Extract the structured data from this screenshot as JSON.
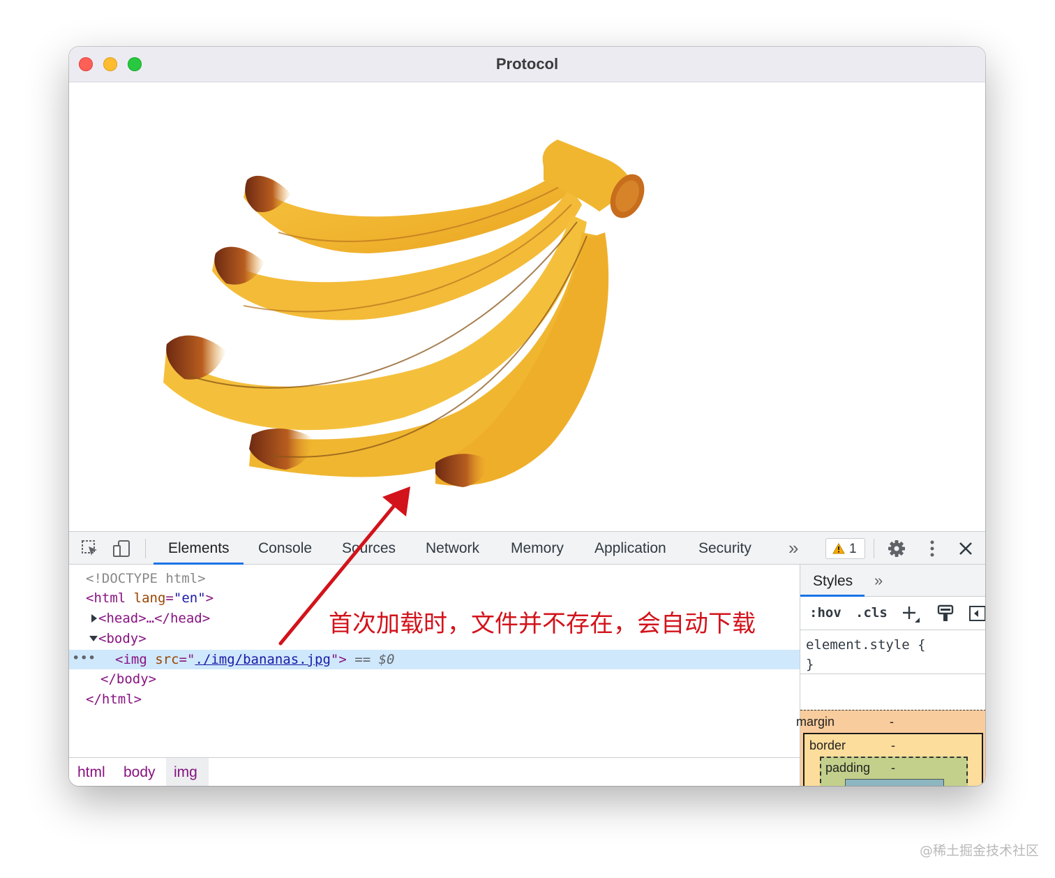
{
  "window": {
    "title": "Protocol"
  },
  "devtools": {
    "tabs": [
      {
        "label": "Elements",
        "active": true
      },
      {
        "label": "Console"
      },
      {
        "label": "Sources"
      },
      {
        "label": "Network"
      },
      {
        "label": "Memory"
      },
      {
        "label": "Application"
      },
      {
        "label": "Security"
      }
    ],
    "more_tabs_label": "»",
    "warning_count": "1",
    "close_label": "✕",
    "dom": {
      "doctype": "<!DOCTYPE html>",
      "html_open_tag": "<html",
      "html_attr_name": "lang",
      "html_attr_value": "\"en\"",
      "head_collapsed": "<head>…</head>",
      "body_open": "<body>",
      "img_tag_open": "<img",
      "img_attr_name": "src",
      "img_src": "./img/bananas.jpg",
      "img_marker": "== $0",
      "body_close": "</body>",
      "html_close": "</html>"
    },
    "breadcrumbs": [
      "html",
      "body",
      "img"
    ],
    "styles": {
      "tab_label": "Styles",
      "more_label": "»",
      "hov_label": ":hov",
      "cls_label": ".cls",
      "rule_selector": "element.style {",
      "rule_close": "}",
      "box_model": {
        "margin_label": "margin",
        "margin_value": "-",
        "border_label": "border",
        "border_value": "-",
        "padding_label": "padding",
        "padding_value": "-"
      }
    }
  },
  "annotation": {
    "text": "首次加载时，文件并不存在，会自动下载",
    "color": "#d2131b"
  },
  "watermark": "@稀土掘金技术社区",
  "icons": [
    "inspect-icon",
    "device-toolbar-icon",
    "warning-icon",
    "gear-icon",
    "kebab-menu-icon",
    "close-icon",
    "new-rule-icon",
    "paint-brush-icon",
    "sidebar-toggle-icon",
    "expand-triangle-icon"
  ]
}
